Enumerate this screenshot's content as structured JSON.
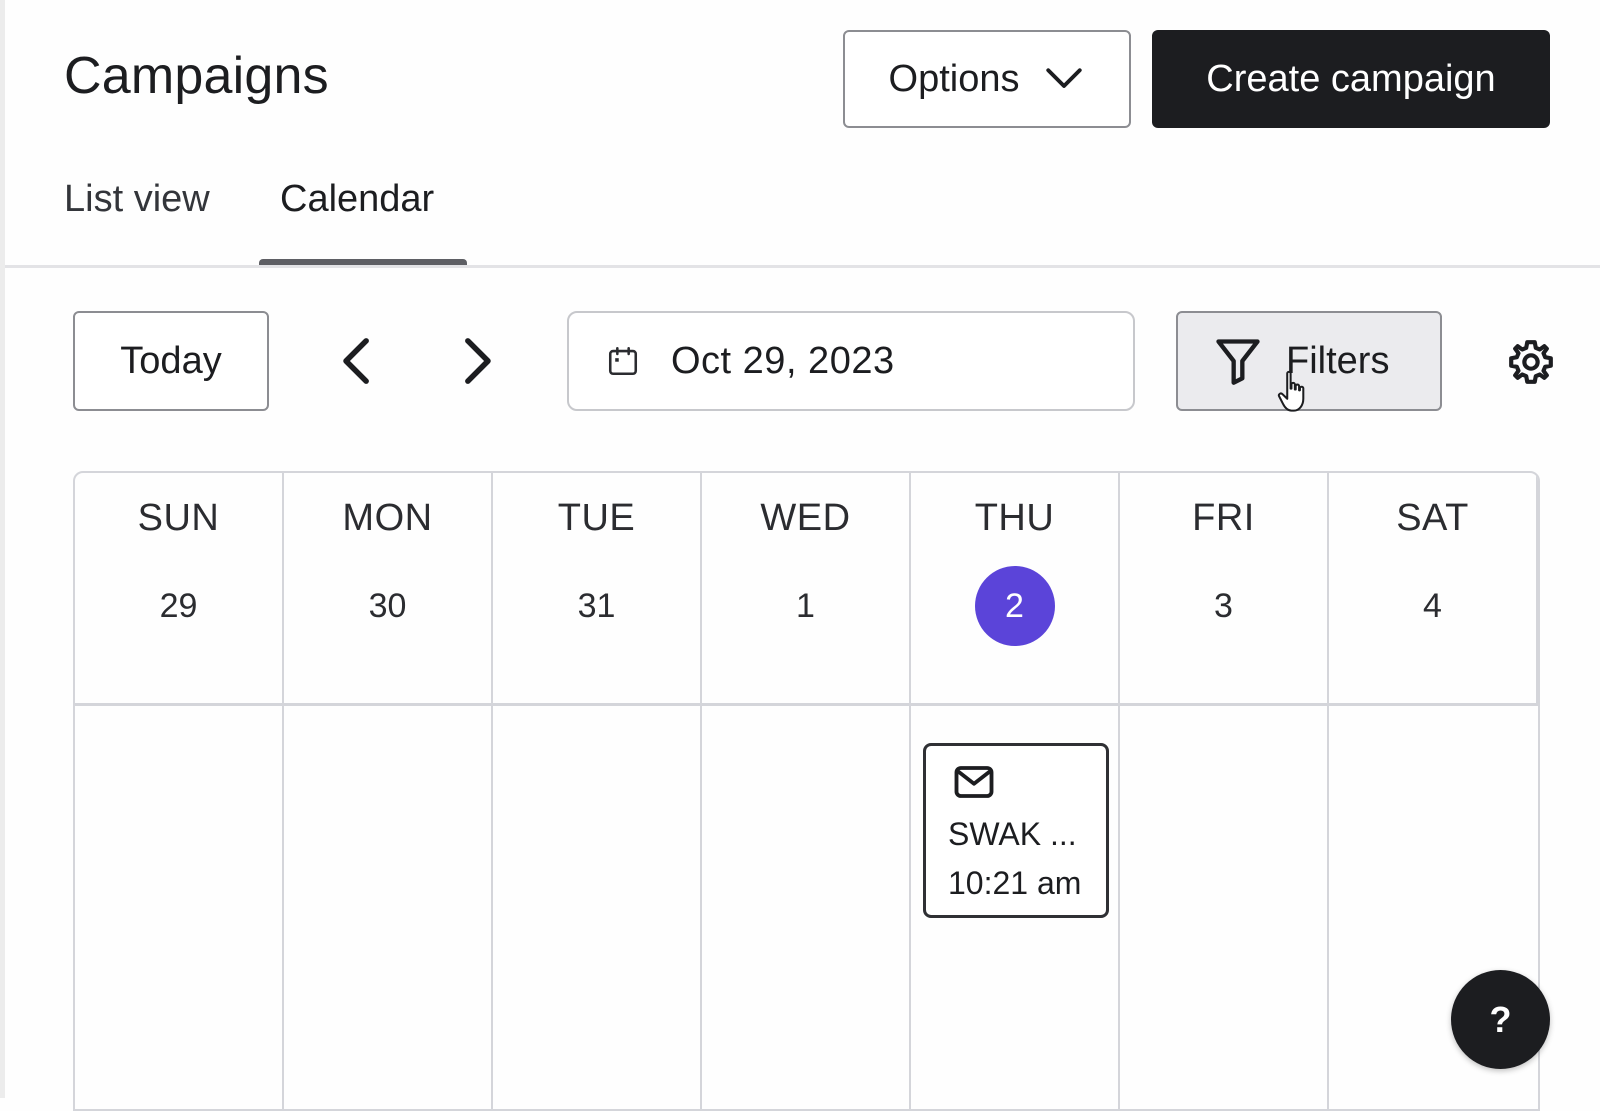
{
  "header": {
    "title": "Campaigns",
    "options_label": "Options",
    "create_label": "Create campaign"
  },
  "tabs": [
    {
      "label": "List view",
      "active": false
    },
    {
      "label": "Calendar",
      "active": true
    }
  ],
  "toolbar": {
    "today_label": "Today",
    "date_value": "Oct 29, 2023",
    "filters_label": "Filters"
  },
  "calendar": {
    "days": [
      {
        "dow": "SUN",
        "num": "29"
      },
      {
        "dow": "MON",
        "num": "30"
      },
      {
        "dow": "TUE",
        "num": "31"
      },
      {
        "dow": "WED",
        "num": "1"
      },
      {
        "dow": "THU",
        "num": "2",
        "today": true
      },
      {
        "dow": "FRI",
        "num": "3"
      },
      {
        "dow": "SAT",
        "num": "4"
      }
    ],
    "event": {
      "title": "SWAK ...",
      "time": "10:21 am",
      "icon": "envelope-icon"
    }
  },
  "help": {
    "label": "?"
  },
  "colors": {
    "primary_dark": "#1c1d20",
    "today_accent": "#5b44d9",
    "filters_bg": "#ebebee"
  },
  "icons": {
    "options": "chevron-down-icon",
    "prev": "chevron-left-icon",
    "next": "chevron-right-icon",
    "date": "calendar-icon",
    "filters": "funnel-icon",
    "settings": "gear-icon",
    "cursor": "pointer-hand-icon"
  }
}
